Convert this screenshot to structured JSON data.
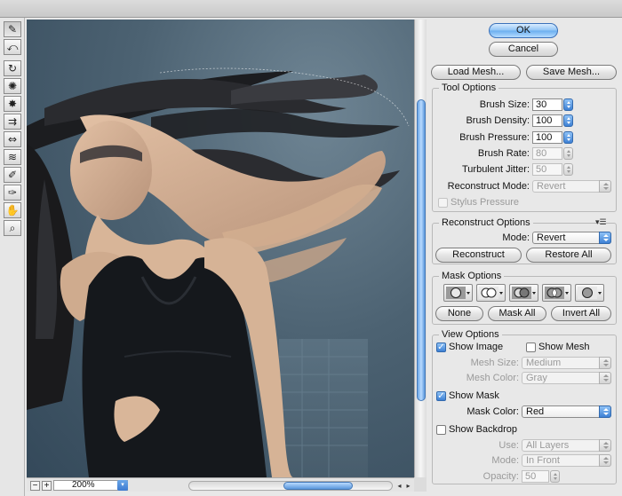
{
  "buttons": {
    "ok": "OK",
    "cancel": "Cancel",
    "load_mesh": "Load Mesh...",
    "save_mesh": "Save Mesh..."
  },
  "tool_options": {
    "title": "Tool Options",
    "brush_size": {
      "label": "Brush Size:",
      "value": "30"
    },
    "brush_density": {
      "label": "Brush Density:",
      "value": "100"
    },
    "brush_pressure": {
      "label": "Brush Pressure:",
      "value": "100"
    },
    "brush_rate": {
      "label": "Brush Rate:",
      "value": "80"
    },
    "turbulent_jitter": {
      "label": "Turbulent Jitter:",
      "value": "50"
    },
    "reconstruct_mode": {
      "label": "Reconstruct Mode:",
      "value": "Revert"
    },
    "stylus_pressure": {
      "label": "Stylus Pressure",
      "checked": false
    }
  },
  "reconstruct_options": {
    "title": "Reconstruct Options",
    "mode": {
      "label": "Mode:",
      "value": "Revert"
    },
    "reconstruct_label": "Reconstruct",
    "restore_all_label": "Restore All"
  },
  "mask_options": {
    "title": "Mask Options",
    "none_label": "None",
    "mask_all_label": "Mask All",
    "invert_all_label": "Invert All"
  },
  "view_options": {
    "title": "View Options",
    "show_image": {
      "label": "Show Image",
      "checked": true
    },
    "show_mesh": {
      "label": "Show Mesh",
      "checked": false
    },
    "mesh_size": {
      "label": "Mesh Size:",
      "value": "Medium"
    },
    "mesh_color": {
      "label": "Mesh Color:",
      "value": "Gray"
    },
    "show_mask": {
      "label": "Show Mask",
      "checked": true
    },
    "mask_color": {
      "label": "Mask Color:",
      "value": "Red"
    },
    "show_backdrop": {
      "label": "Show Backdrop",
      "checked": false
    },
    "use": {
      "label": "Use:",
      "value": "All Layers"
    },
    "mode": {
      "label": "Mode:",
      "value": "In Front"
    },
    "opacity": {
      "label": "Opacity:",
      "value": "50"
    }
  },
  "status": {
    "zoom": "200%",
    "zoom_out": "−",
    "zoom_in": "+"
  },
  "tools": [
    "forward-warp-icon",
    "reconstruct-icon",
    "twirl-icon",
    "pucker-icon",
    "bloat-icon",
    "push-left-icon",
    "mirror-icon",
    "turbulence-icon",
    "freeze-mask-icon",
    "thaw-mask-icon",
    "hand-icon",
    "zoom-icon"
  ],
  "colors": {
    "accent": "#5b9be6",
    "panel_bg": "#e8e8e8",
    "photo_sky": "#4c6272"
  }
}
